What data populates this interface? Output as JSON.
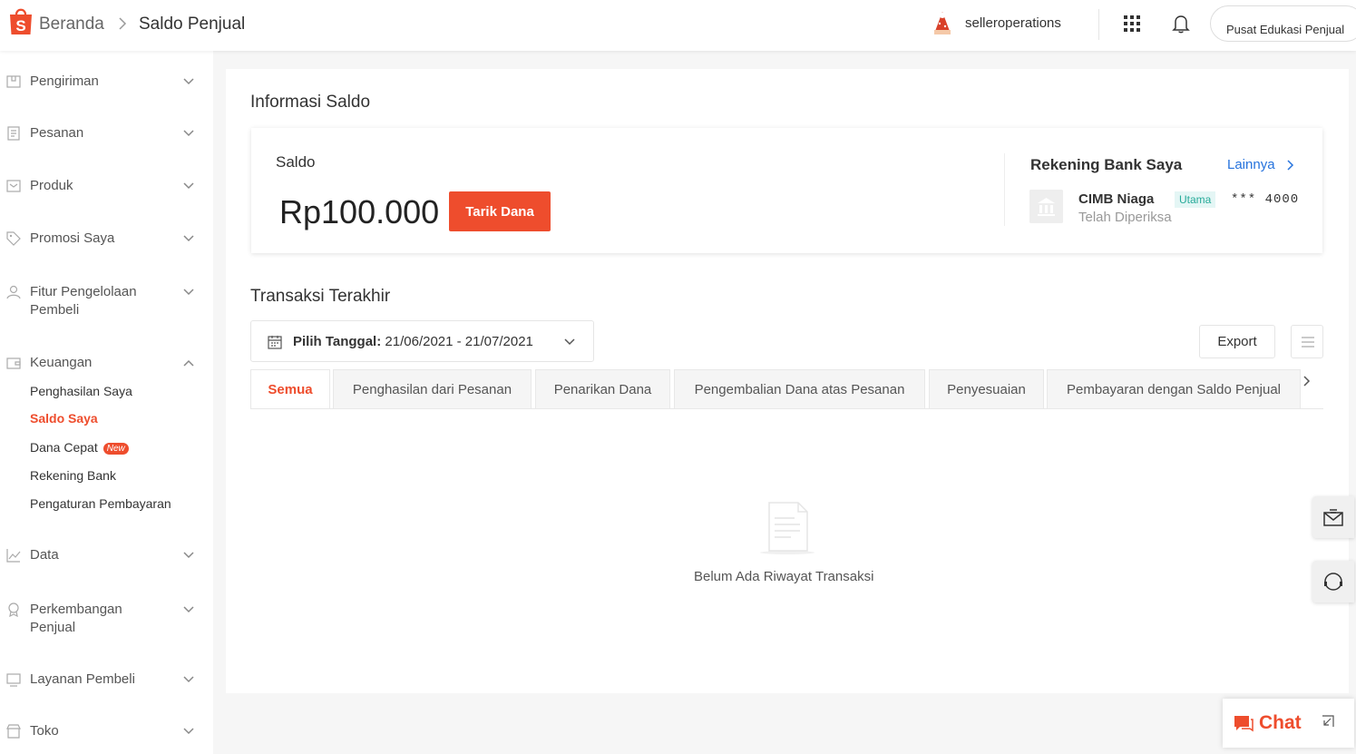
{
  "header": {
    "breadcrumb_home": "Beranda",
    "breadcrumb_current": "Saldo Penjual",
    "username": "selleroperations",
    "edu_button": "Pusat Edukasi Penjual"
  },
  "sidebar": {
    "items": [
      {
        "label": "Pengiriman",
        "icon": "truck-icon"
      },
      {
        "label": "Pesanan",
        "icon": "clipboard-icon"
      },
      {
        "label": "Produk",
        "icon": "box-icon"
      },
      {
        "label": "Promosi Saya",
        "icon": "tag-icon"
      },
      {
        "label": "Fitur Pengelolaan Pembeli",
        "icon": "people-icon"
      },
      {
        "label": "Keuangan",
        "icon": "wallet-icon"
      },
      {
        "label": "Data",
        "icon": "chart-icon"
      },
      {
        "label": "Perkembangan Penjual",
        "icon": "medal-icon"
      },
      {
        "label": "Layanan Pembeli",
        "icon": "monitor-icon"
      },
      {
        "label": "Toko",
        "icon": "shop-icon"
      }
    ],
    "keuangan_sub": {
      "penghasilan": "Penghasilan Saya",
      "saldo": "Saldo Saya",
      "dana_cepat": "Dana Cepat",
      "dana_cepat_badge": "New",
      "rekening": "Rekening Bank",
      "pengaturan": "Pengaturan Pembayaran"
    }
  },
  "saldo": {
    "section_title": "Informasi Saldo",
    "label": "Saldo",
    "amount": "Rp100.000",
    "withdraw_button": "Tarik Dana",
    "bank_title": "Rekening Bank Saya",
    "more_link": "Lainnya",
    "bank_name": "CIMB Niaga",
    "bank_tag": "Utama",
    "account_masked": "*** 4000",
    "bank_status": "Telah Diperiksa"
  },
  "transactions": {
    "section_title": "Transaksi Terakhir",
    "date_label": "Pilih Tanggal:",
    "date_range": "21/06/2021 - 21/07/2021",
    "export_button": "Export",
    "tabs": [
      "Semua",
      "Penghasilan dari Pesanan",
      "Penarikan Dana",
      "Pengembalian Dana atas Pesanan",
      "Penyesuaian",
      "Pembayaran dengan Saldo Penjual"
    ],
    "active_tab": "Semua",
    "empty_text": "Belum Ada Riwayat Transaksi"
  },
  "chat": {
    "label": "Chat"
  },
  "colors": {
    "brand": "#ee4d2d",
    "link": "#2673dd",
    "tag_green": "#26aa99"
  }
}
